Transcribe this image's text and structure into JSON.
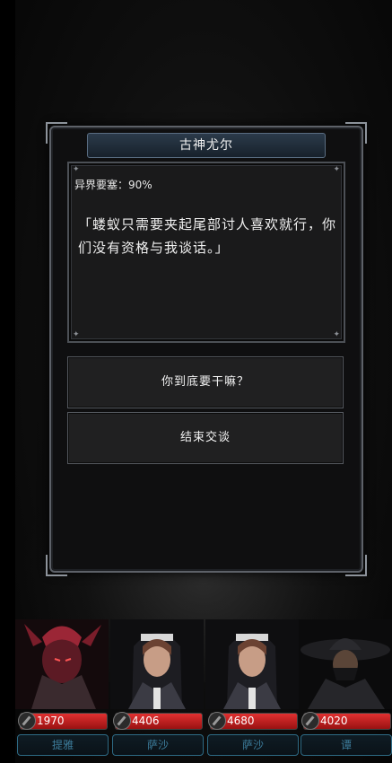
{
  "dialog": {
    "speaker": "古神尤尔",
    "status": "异界要塞：90%",
    "quote": "「蝼蚁只需要夹起尾部讨人喜欢就行，你们没有资格与我谈话。」",
    "choices": [
      {
        "label": "你到底要干嘛？"
      },
      {
        "label": "结束交谈"
      }
    ]
  },
  "party": [
    {
      "hp": "1970",
      "name": "提雅",
      "icon": "demon-warrior-portrait"
    },
    {
      "hp": "4406",
      "name": "萨沙",
      "icon": "nun-portrait"
    },
    {
      "hp": "4680",
      "name": "萨沙",
      "icon": "nun-portrait"
    },
    {
      "hp": "4020",
      "name": "谭",
      "icon": "hooded-hunter-portrait"
    }
  ],
  "colors": {
    "hp_bar": "#c21f1f",
    "name_plate_border": "#2d6a84",
    "title_bar": "#22303d"
  }
}
